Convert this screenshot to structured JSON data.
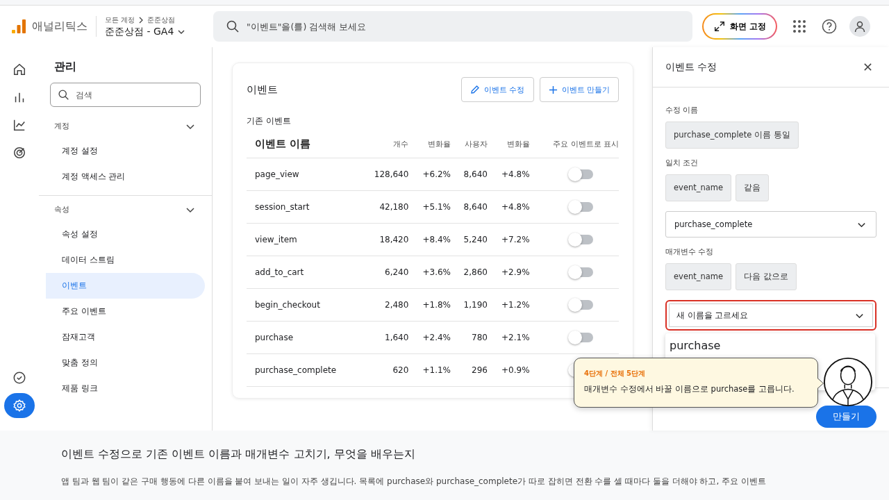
{
  "header": {
    "app_name": "애널리틱스",
    "breadcrumb": [
      "모든 계정",
      "준준상점"
    ],
    "property": "준준상점 - GA4",
    "search": {
      "placeholder": "\"이벤트\"을(를) 검색해 보세요"
    },
    "pin_button": "화면 고정"
  },
  "rail": [
    {
      "kind": "home",
      "selected": false
    },
    {
      "kind": "reports",
      "selected": false
    },
    {
      "kind": "explore",
      "selected": false
    },
    {
      "kind": "advertising",
      "selected": false
    },
    {
      "kind": "check",
      "selected": false
    },
    {
      "kind": "settings",
      "selected": true
    }
  ],
  "admin": {
    "title": "관리",
    "search": {
      "placeholder": "검색"
    },
    "sections": [
      {
        "label": "계정",
        "expanded": true,
        "items": [
          {
            "label": "계정 설정",
            "selected": false
          },
          {
            "label": "계정 액세스 관리",
            "selected": false
          }
        ]
      },
      {
        "label": "속성",
        "expanded": true,
        "items": [
          {
            "label": "속성 설정",
            "selected": false
          },
          {
            "label": "데이터 스트림",
            "selected": false
          },
          {
            "label": "이벤트",
            "selected": true
          },
          {
            "label": "주요 이벤트",
            "selected": false
          },
          {
            "label": "잠재고객",
            "selected": false
          },
          {
            "label": "맞춤 정의",
            "selected": false
          },
          {
            "label": "제품 링크",
            "selected": false
          }
        ]
      }
    ]
  },
  "events_card": {
    "title": "이벤트",
    "buttons": [
      {
        "kind": "edit",
        "label": "이벤트 수정"
      },
      {
        "kind": "create",
        "label": "이벤트 만들기"
      }
    ],
    "subtitle": "기존 이벤트",
    "columns": [
      "이벤트 이름",
      "개수",
      "변화율",
      "사용자",
      "변화율",
      "주요 이벤트로 표시"
    ],
    "rows": [
      {
        "name": "page_view",
        "count": "128,640",
        "count_change": "+6.2%",
        "users": "8,640",
        "users_change": "+4.8%",
        "key_event": false
      },
      {
        "name": "session_start",
        "count": "42,180",
        "count_change": "+5.1%",
        "users": "8,640",
        "users_change": "+4.8%",
        "key_event": false
      },
      {
        "name": "view_item",
        "count": "18,420",
        "count_change": "+8.4%",
        "users": "5,240",
        "users_change": "+7.2%",
        "key_event": false
      },
      {
        "name": "add_to_cart",
        "count": "6,240",
        "count_change": "+3.6%",
        "users": "2,860",
        "users_change": "+2.9%",
        "key_event": false
      },
      {
        "name": "begin_checkout",
        "count": "2,480",
        "count_change": "+1.8%",
        "users": "1,190",
        "users_change": "+1.2%",
        "key_event": false
      },
      {
        "name": "purchase",
        "count": "1,640",
        "count_change": "+2.4%",
        "users": "780",
        "users_change": "+2.1%",
        "key_event": false
      },
      {
        "name": "purchase_complete",
        "count": "620",
        "count_change": "+1.1%",
        "users": "296",
        "users_change": "+0.9%",
        "key_event": false
      }
    ]
  },
  "edit_panel": {
    "title": "이벤트 수정",
    "name_label": "수정 이름",
    "name_value": "purchase_complete 이름 통일",
    "match_label": "일치 조건",
    "match_chips": [
      "event_name",
      "같음"
    ],
    "match_value": "purchase_complete",
    "param_label": "매개변수 수정",
    "param_chips": [
      "event_name",
      "다음 값으로"
    ],
    "new_name": {
      "placeholder": "새 이름을 고르세요",
      "highlighted": true
    },
    "options": [
      "purchase"
    ],
    "create_button": "만들기"
  },
  "tutorial": {
    "step": "4단계 / 전체 5단계",
    "text": "매개변수 수정에서 바꿀 이름으로 purchase를 고릅니다."
  },
  "lesson": {
    "title": "이벤트 수정으로 기존 이벤트 이름과 매개변수 고치기, 무엇을 배우는지",
    "text": "앱 팀과 웹 팀이 같은 구매 행동에 다른 이름을 붙여 보내는 일이 자주 생깁니다. 목록에 purchase와 purchase_complete가 따로 잡히면 전환 수를 셀 때마다 둘을 더해야 하고, 주요 이벤트"
  }
}
